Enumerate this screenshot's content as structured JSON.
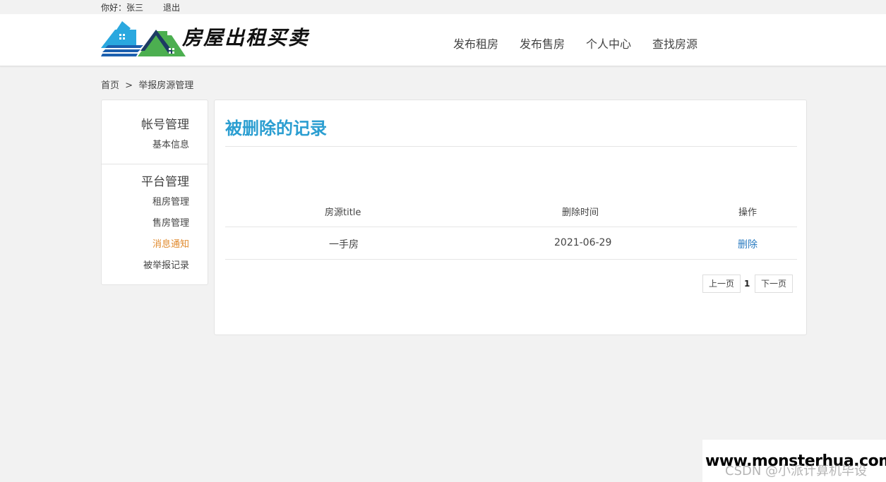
{
  "topbar": {
    "greeting": "你好：张三",
    "logout": "退出"
  },
  "header": {
    "site_title": "房屋出租买卖",
    "nav": [
      "发布租房",
      "发布售房",
      "个人中心",
      "查找房源"
    ],
    "logo_colors": {
      "roof_blue": "#2aa8df",
      "roof_green": "#4caf50",
      "base_blue": "#1b5fae"
    }
  },
  "breadcrumb": {
    "home": "首页",
    "sep": ">",
    "current": "举报房源管理"
  },
  "sidebar": {
    "section1_title": "帐号管理",
    "section1_items": [
      "基本信息"
    ],
    "section2_title": "平台管理",
    "section2_items": [
      "租房管理",
      "售房管理",
      "消息通知",
      "被举报记录"
    ],
    "active_item": "消息通知"
  },
  "main": {
    "title": "被删除的记录",
    "table": {
      "headers": [
        "房源title",
        "删除时间",
        "操作"
      ],
      "rows": [
        {
          "title": "一手房",
          "time": "2021-06-29",
          "action": "删除"
        }
      ]
    },
    "pagination": {
      "prev": "上一页",
      "current": "1",
      "next": "下一页"
    }
  },
  "watermark": {
    "url": "www.monsterhua.com",
    "csdn": "CSDN @小派计算机毕设"
  },
  "colors": {
    "accent": "#2b9ed1",
    "active_side": "#e08a2e",
    "link": "#2b7cc1"
  }
}
